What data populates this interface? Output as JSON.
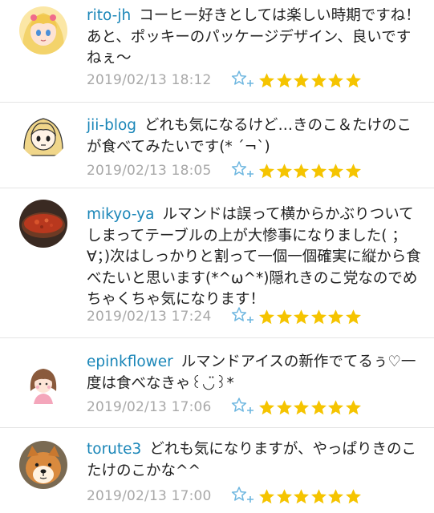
{
  "colors": {
    "username": "#1a86b8",
    "text": "#222222",
    "date": "#a8a8a8",
    "star": "#f5c400",
    "fav_icon": "#6fb7e0"
  },
  "comments": [
    {
      "user": "rito-jh",
      "text": "コーヒー好きとしては楽しい時期ですね！あと、ポッキーのパッケージデザイン、良いですねぇ〜",
      "date": "2019/02/13 18:12",
      "stars": 6,
      "avatar": "anime-girl-avatar"
    },
    {
      "user": "jii-blog",
      "text": "どれも気になるけど…きのこ＆たけのこが食べてみたいです(* ´¬`)",
      "date": "2019/02/13 18:05",
      "stars": 6,
      "avatar": "blonde-girl-avatar"
    },
    {
      "user": "mikyo-ya",
      "text": "ルマンドは誤って横からかぶりついてしまってテーブルの上が大惨事になりました( ；∀；)次はしっかりと割って一個一個確実に縦から食べたいと思います(*^ω^*)隠れきのこ党なのでめちゃくちゃ気になります！",
      "date": "2019/02/13 17:24",
      "stars": 6,
      "avatar": "food-photo-avatar"
    },
    {
      "user": "epinkflower",
      "text": "ルマンドアイスの新作でてるぅ♡一度は食べなきゃ꒰◡̈꒱*",
      "date": "2019/02/13 17:06",
      "stars": 6,
      "avatar": "girl-illustration-avatar"
    },
    {
      "user": "torute3",
      "text": "どれも気になりますが、やっぱりきのこたけのこかな^^",
      "date": "2019/02/13 17:00",
      "stars": 6,
      "avatar": "shiba-dog-avatar"
    }
  ]
}
